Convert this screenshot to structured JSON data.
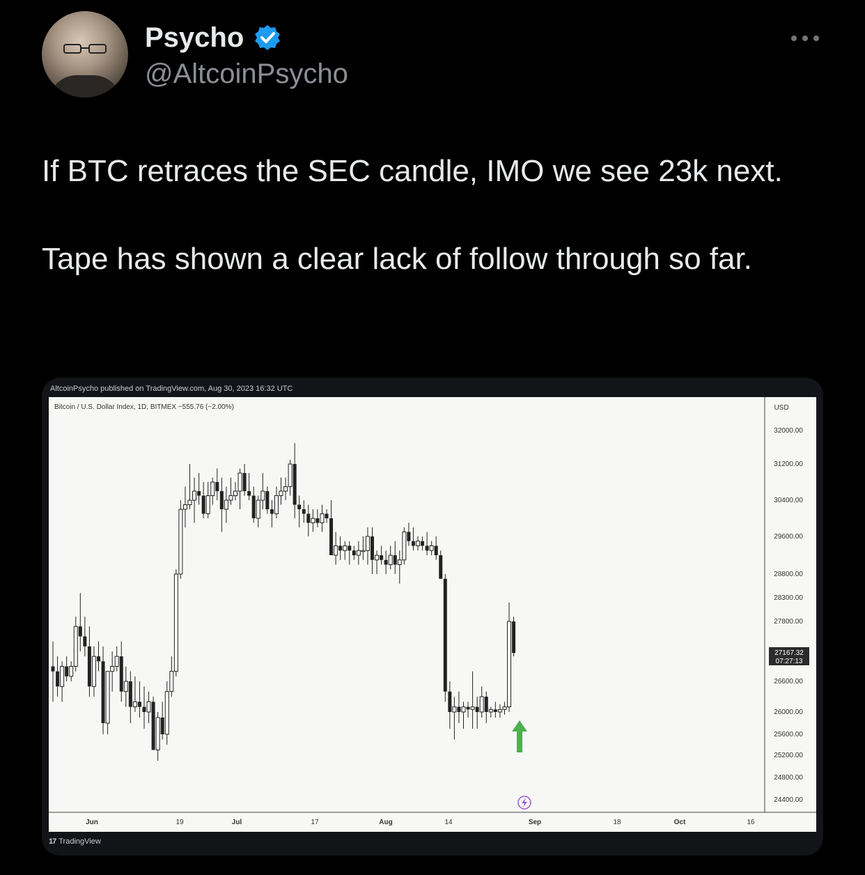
{
  "user": {
    "display_name": "Psycho",
    "handle": "@AltcoinPsycho",
    "avatar_icon": "avatar-icon",
    "verified_icon": "verified-badge-icon",
    "verified_color": "#1d9bf0"
  },
  "tweet": {
    "paragraph1": "If BTC retraces the SEC candle, IMO we see 23k next.",
    "paragraph2": "Tape has shown a clear lack of follow through so far."
  },
  "media": {
    "published": "AltcoinPsycho published on TradingView.com, Aug 30, 2023 16:32 UTC",
    "symbol": "Bitcoin / U.S. Dollar Index, 1D, BITMEX  −555.76 (−2.00%)",
    "footer_logo": "TradingView",
    "arrow_color": "#4caf50"
  },
  "chart_data": {
    "type": "candlestick",
    "currency_label": "USD",
    "y_ticks": [
      "32000.00",
      "31200.00",
      "30400.00",
      "29600.00",
      "28800.00",
      "28300.00",
      "27800.00",
      "26600.00",
      "26000.00",
      "25600.00",
      "25200.00",
      "24800.00",
      "24400.00"
    ],
    "last_price": "27167.32",
    "countdown": "07:27:13",
    "x_ticks": [
      "Jun",
      "19",
      "Jul",
      "17",
      "Aug",
      "14",
      "Sep",
      "18",
      "Oct",
      "16"
    ],
    "series": [
      {
        "name": "BTC price",
        "ohlc": [
          [
            26900,
            27400,
            26200,
            26800
          ],
          [
            26800,
            27100,
            26300,
            26500
          ],
          [
            26500,
            27000,
            26200,
            26900
          ],
          [
            26900,
            27100,
            26600,
            26700
          ],
          [
            26700,
            27000,
            26600,
            26900
          ],
          [
            26900,
            27900,
            26800,
            27700
          ],
          [
            27700,
            28400,
            27200,
            27500
          ],
          [
            27500,
            27900,
            27100,
            27300
          ],
          [
            27300,
            27700,
            26300,
            26500
          ],
          [
            26500,
            27300,
            26300,
            27100
          ],
          [
            27100,
            27400,
            26800,
            27000
          ],
          [
            27000,
            27300,
            25600,
            25800
          ],
          [
            25800,
            26800,
            25600,
            26800
          ],
          [
            26800,
            27200,
            26400,
            26900
          ],
          [
            26900,
            27300,
            26800,
            27100
          ],
          [
            27100,
            27400,
            26200,
            26400
          ],
          [
            26400,
            26900,
            26100,
            26600
          ],
          [
            26600,
            26800,
            25800,
            26100
          ],
          [
            26100,
            26700,
            26000,
            26200
          ],
          [
            26200,
            26600,
            25900,
            26100
          ],
          [
            26100,
            26500,
            25700,
            26000
          ],
          [
            26000,
            26400,
            25800,
            26200
          ],
          [
            26200,
            26300,
            25300,
            25300
          ],
          [
            25300,
            26000,
            25100,
            25900
          ],
          [
            25900,
            26200,
            25500,
            25600
          ],
          [
            25600,
            26600,
            25400,
            26400
          ],
          [
            26400,
            27100,
            26300,
            26800
          ],
          [
            26800,
            28900,
            26700,
            28800
          ],
          [
            28800,
            30400,
            28700,
            30200
          ],
          [
            30200,
            30700,
            29800,
            30300
          ],
          [
            30300,
            31200,
            30200,
            30400
          ],
          [
            30400,
            30900,
            29900,
            30600
          ],
          [
            30600,
            31000,
            30300,
            30500
          ],
          [
            30500,
            30800,
            30000,
            30100
          ],
          [
            30100,
            30800,
            30000,
            30500
          ],
          [
            30500,
            30900,
            30300,
            30800
          ],
          [
            30800,
            31100,
            30400,
            30600
          ],
          [
            30600,
            30900,
            29700,
            30200
          ],
          [
            30200,
            30700,
            29900,
            30400
          ],
          [
            30400,
            30900,
            30300,
            30500
          ],
          [
            30500,
            30800,
            30400,
            30600
          ],
          [
            30600,
            31100,
            30200,
            31000
          ],
          [
            31000,
            31200,
            30500,
            30600
          ],
          [
            30600,
            31000,
            30400,
            30500
          ],
          [
            30500,
            30700,
            29900,
            30000
          ],
          [
            30000,
            30500,
            29800,
            30400
          ],
          [
            30400,
            31000,
            30200,
            30600
          ],
          [
            30600,
            30700,
            30100,
            30200
          ],
          [
            30200,
            30400,
            29800,
            30100
          ],
          [
            30100,
            30700,
            30000,
            30500
          ],
          [
            30500,
            30900,
            30300,
            30600
          ],
          [
            30600,
            30900,
            30400,
            30700
          ],
          [
            30700,
            31300,
            30500,
            31200
          ],
          [
            31200,
            31700,
            30000,
            30300
          ],
          [
            30300,
            30500,
            29800,
            30200
          ],
          [
            30200,
            30400,
            29900,
            30100
          ],
          [
            30100,
            30300,
            29600,
            29900
          ],
          [
            29900,
            30200,
            29700,
            30000
          ],
          [
            30000,
            30200,
            29800,
            29900
          ],
          [
            29900,
            30300,
            29700,
            30100
          ],
          [
            30100,
            30200,
            29900,
            30000
          ],
          [
            30000,
            30400,
            29300,
            29200
          ],
          [
            29200,
            29700,
            29000,
            29400
          ],
          [
            29400,
            29600,
            29100,
            29300
          ],
          [
            29300,
            29500,
            29100,
            29400
          ],
          [
            29400,
            29500,
            29000,
            29300
          ],
          [
            29300,
            29400,
            29100,
            29200
          ],
          [
            29200,
            29500,
            29000,
            29300
          ],
          [
            29300,
            29600,
            29100,
            29300
          ],
          [
            29300,
            29800,
            29000,
            29600
          ],
          [
            29600,
            29800,
            28800,
            29100
          ],
          [
            29100,
            29300,
            28800,
            29200
          ],
          [
            29200,
            29400,
            29000,
            29100
          ],
          [
            29100,
            29300,
            28800,
            29000
          ],
          [
            29000,
            29400,
            28900,
            29200
          ],
          [
            29200,
            29500,
            28800,
            29000
          ],
          [
            29000,
            29300,
            28600,
            29100
          ],
          [
            29100,
            29800,
            29000,
            29700
          ],
          [
            29700,
            29900,
            29400,
            29500
          ],
          [
            29500,
            29800,
            29300,
            29400
          ],
          [
            29400,
            29600,
            29300,
            29500
          ],
          [
            29500,
            29600,
            29300,
            29400
          ],
          [
            29400,
            29700,
            29200,
            29300
          ],
          [
            29300,
            29500,
            29200,
            29400
          ],
          [
            29400,
            29600,
            29100,
            29200
          ],
          [
            29200,
            29300,
            28700,
            28700
          ],
          [
            28700,
            28800,
            26200,
            26400
          ],
          [
            26400,
            26600,
            25700,
            26000
          ],
          [
            26000,
            26300,
            25500,
            26100
          ],
          [
            26100,
            26400,
            25800,
            26000
          ],
          [
            26000,
            26200,
            25700,
            26100
          ],
          [
            26100,
            26200,
            25900,
            26050
          ],
          [
            26050,
            26800,
            25700,
            26100
          ],
          [
            26100,
            26300,
            25700,
            26000
          ],
          [
            26000,
            26500,
            25900,
            26300
          ],
          [
            26300,
            26400,
            25800,
            26000
          ],
          [
            26000,
            26100,
            25900,
            26050
          ],
          [
            26050,
            26200,
            25900,
            26000
          ],
          [
            26000,
            26150,
            25900,
            26050
          ],
          [
            26050,
            26200,
            25950,
            26100
          ],
          [
            26100,
            28200,
            26000,
            27800
          ],
          [
            27800,
            27900,
            27100,
            27167
          ]
        ]
      }
    ]
  }
}
